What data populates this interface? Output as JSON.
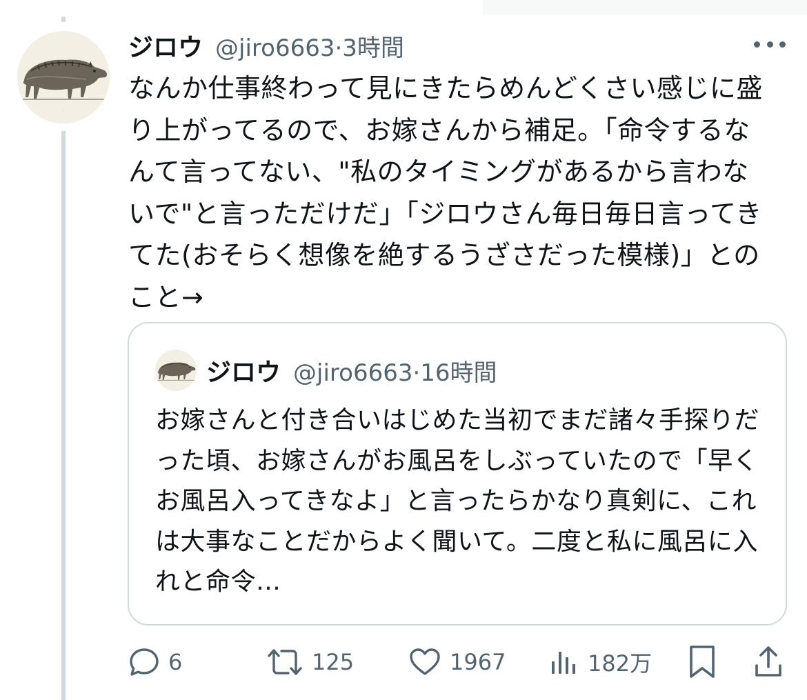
{
  "tweet": {
    "author_name": "ジロウ",
    "author_handle": "@jiro6663",
    "separator": "·",
    "time": "3時間",
    "text": "なんか仕事終わって見にきたらめんどくさい感じに盛り上がってるので、お嫁さんから補足。「命令するなんて言ってない、\"私のタイミングがあるから言わないで\"と言っただけだ」「ジロウさん毎日毎日言ってきてた(おそらく想像を絶するうざさだった模様)」とのこと→"
  },
  "quoted_tweet": {
    "author_name": "ジロウ",
    "author_handle": "@jiro6663",
    "separator": "·",
    "time": "16時間",
    "text": "お嫁さんと付き合いはじめた当初でまだ諸々手探りだった頃、お嫁さんがお風呂をしぶっていたので「早くお風呂入ってきなよ」と言ったらかなり真剣に、これは大事なことだからよく聞いて。二度と私に風呂に入れと命令…"
  },
  "actions": {
    "reply_count": "6",
    "retweet_count": "125",
    "like_count": "1967",
    "views_count": "182万"
  },
  "icons": {
    "more": "more-dots-icon",
    "reply": "reply-icon",
    "retweet": "retweet-icon",
    "like": "heart-icon",
    "views": "views-chart-icon",
    "bookmark": "bookmark-icon",
    "share": "share-icon"
  },
  "colors": {
    "text": "#0f1419",
    "secondary": "#536471",
    "border": "#cfd9de"
  }
}
